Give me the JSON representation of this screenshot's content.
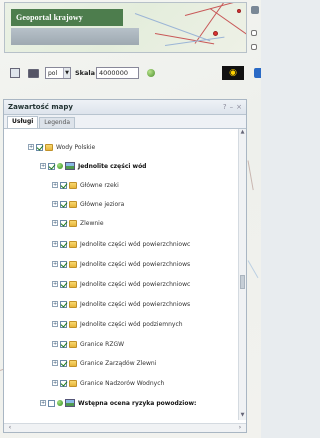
{
  "header": {
    "title": "Geoportal krajowy"
  },
  "toolbar": {
    "language": "pol",
    "scale_label": "Skala",
    "scale_value": "4000000",
    "icons": [
      "map-icon",
      "printer-icon",
      "go-icon",
      "eye-icon"
    ]
  },
  "panel": {
    "title": "Zawartość mapy",
    "tabs": [
      {
        "label": "Usługi",
        "active": true
      },
      {
        "label": "Legenda",
        "active": false
      }
    ]
  },
  "tree": [
    {
      "label": "Wody Polskie",
      "checked": true,
      "bold": false
    },
    {
      "label": "Jednolite części wód",
      "checked": true,
      "bold": true
    },
    {
      "label": "Główne rzeki",
      "checked": true,
      "bold": false
    },
    {
      "label": "Główne jeziora",
      "checked": true,
      "bold": false
    },
    {
      "label": "Zlewnie",
      "checked": true,
      "bold": false
    },
    {
      "label": "Jednolite części wód powierzchniowc",
      "checked": true,
      "bold": false
    },
    {
      "label": "Jednolite części wód powierzchniows",
      "checked": true,
      "bold": false
    },
    {
      "label": "Jednolite części wód powierzchniowc",
      "checked": true,
      "bold": false
    },
    {
      "label": "Jednolite części wód powierzchniows",
      "checked": true,
      "bold": false
    },
    {
      "label": "Jednolite części wód podziemnych",
      "checked": true,
      "bold": false
    },
    {
      "label": "Granice RZGW",
      "checked": true,
      "bold": false
    },
    {
      "label": "Granice Zarządów Zlewni",
      "checked": true,
      "bold": false
    },
    {
      "label": "Granice Nadzorów Wodnych",
      "checked": true,
      "bold": false
    },
    {
      "label": "Wstępna ocena ryzyka powodziow:",
      "checked": false,
      "bold": true
    }
  ],
  "colors": {
    "header_green": "#4d7d4d",
    "eye_button_bg": "#111111",
    "eye_color": "#ffd200"
  }
}
